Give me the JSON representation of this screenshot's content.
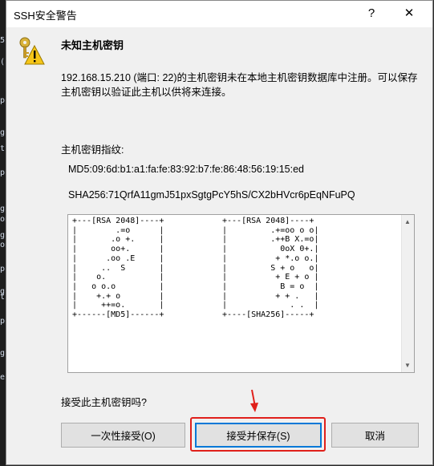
{
  "background": {
    "fragments": [
      "5",
      "(",
      "p",
      "g",
      "t",
      "p",
      "g",
      "on",
      "g",
      "on",
      "p",
      "g",
      "t",
      "p",
      "g",
      "e"
    ]
  },
  "dialog": {
    "title": "SSH安全警告",
    "help_label": "?",
    "close_label": "✕",
    "heading": "未知主机密钥",
    "message": "192.168.15.210 (端口: 22)的主机密钥未在本地主机密钥数据库中注册。可以保存主机密钥以验证此主机以供将来连接。",
    "fingerprint_label": "主机密钥指纹:",
    "md5": "MD5:09:6d:b1:a1:fa:fe:83:92:b7:fe:86:48:56:19:15:ed",
    "sha256": "SHA256:71QrfA11gmJ51pxSgtgPcY5hS/CX2bHVcr6pEqNFuPQ",
    "randomart_md5": "+---[RSA 2048]----+\n|        .=o      |\n|       .o +.     |\n|       oo+.      |\n|      .oo .E     |\n|     ..  S       |\n|    o.           |\n|   o o.o         |\n|    +.+ o        |\n|     ++=o.       |\n+------[MD5]------+",
    "randomart_sha256": "+---[RSA 2048]----+\n|         .+=oo o o|\n|         .++B X.=o|\n|           0oX 0+.|\n|          + *.o o.|\n|         S + o   o|\n|          + E + o |\n|           B = o  |\n|          + + .   |\n|             . .  |\n+----[SHA256]-----+",
    "question": "接受此主机密钥吗?",
    "buttons": {
      "once": "一次性接受(O)",
      "accept_save": "接受并保存(S)",
      "cancel": "取消"
    }
  },
  "colors": {
    "focus_border": "#0078d7",
    "annotation_red": "#e0201b"
  }
}
